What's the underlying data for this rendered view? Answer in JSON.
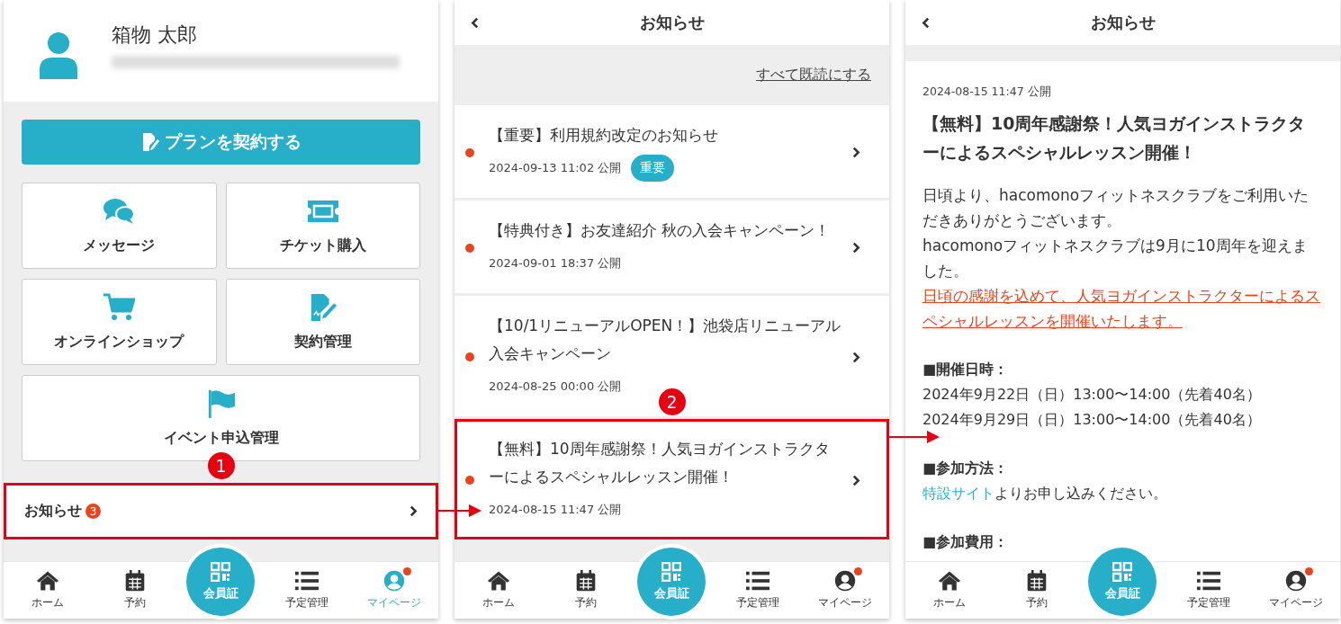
{
  "mypage": {
    "user_name": "箱物 太郎",
    "plan_button": "プランを契約する",
    "menu": [
      {
        "label": "メッセージ"
      },
      {
        "label": "チケット購入"
      },
      {
        "label": "オンラインショップ"
      },
      {
        "label": "契約管理"
      },
      {
        "label": "イベント申込管理"
      }
    ],
    "notice_row": {
      "label": "お知らせ",
      "count": "3",
      "highlighted": true,
      "callout": "1"
    },
    "nav": [
      {
        "label": "ホーム",
        "selected": false
      },
      {
        "label": "予約",
        "selected": false
      },
      {
        "label": "会員証"
      },
      {
        "label": "予定管理",
        "selected": false
      },
      {
        "label": "マイページ",
        "selected": true,
        "notification": true
      }
    ]
  },
  "news_list": {
    "title": "お知らせ",
    "mark_all_read": "すべて既読にする",
    "items": [
      {
        "title": "【重要】利用規約改定のお知らせ",
        "date": "2024-09-13 11:02 公開",
        "unread": true,
        "tag": "重要",
        "highlighted": false
      },
      {
        "title": "【特典付き】お友達紹介 秋の入会キャンペーン！",
        "date": "2024-09-01 18:37 公開",
        "unread": true,
        "highlighted": false
      },
      {
        "title": "【10/1リニューアルOPEN！】池袋店リニューアル入会キャンペーン",
        "date": "2024-08-25 00:00 公開",
        "unread": true,
        "highlighted": false
      },
      {
        "title": "【無料】10周年感謝祭！人気ヨガインストラクターによるスペシャルレッスン開催！",
        "date": "2024-08-15 11:47 公開",
        "unread": true,
        "highlighted": true,
        "callout": "2"
      }
    ],
    "nav": [
      {
        "label": "ホーム",
        "selected": false
      },
      {
        "label": "予約",
        "selected": false
      },
      {
        "label": "会員証"
      },
      {
        "label": "予定管理",
        "selected": false
      },
      {
        "label": "マイページ",
        "selected": false,
        "notification": true
      }
    ]
  },
  "news_detail": {
    "title": "お知らせ",
    "date": "2024-08-15 11:47 公開",
    "heading": "【無料】10周年感謝祭！人気ヨガインストラクターによるスペシャルレッスン開催！",
    "paragraphs": [
      "日頃より、hacomonoフィットネスクラブをご利用いただきありがとうございます。",
      "hacomonoフィットネスクラブは9月に10周年を迎えました。"
    ],
    "highlight_text": "日頃の感謝を込めて、人気ヨガインストラクターによるスペシャルレッスンを開催いたします。",
    "sections": [
      {
        "heading": "■開催日時：",
        "lines": [
          "2024年9月22日（日）13:00〜14:00（先着40名）",
          "2024年9月29日（日）13:00〜14:00（先着40名）"
        ]
      },
      {
        "heading": "■参加方法：",
        "link": "特設サイト",
        "text": "よりお申し込みください。"
      },
      {
        "heading": "■参加費用："
      }
    ],
    "nav": [
      {
        "label": "ホーム",
        "selected": false
      },
      {
        "label": "予約",
        "selected": false
      },
      {
        "label": "会員証"
      },
      {
        "label": "予定管理",
        "selected": false
      },
      {
        "label": "マイページ",
        "selected": false,
        "notification": true
      }
    ]
  }
}
